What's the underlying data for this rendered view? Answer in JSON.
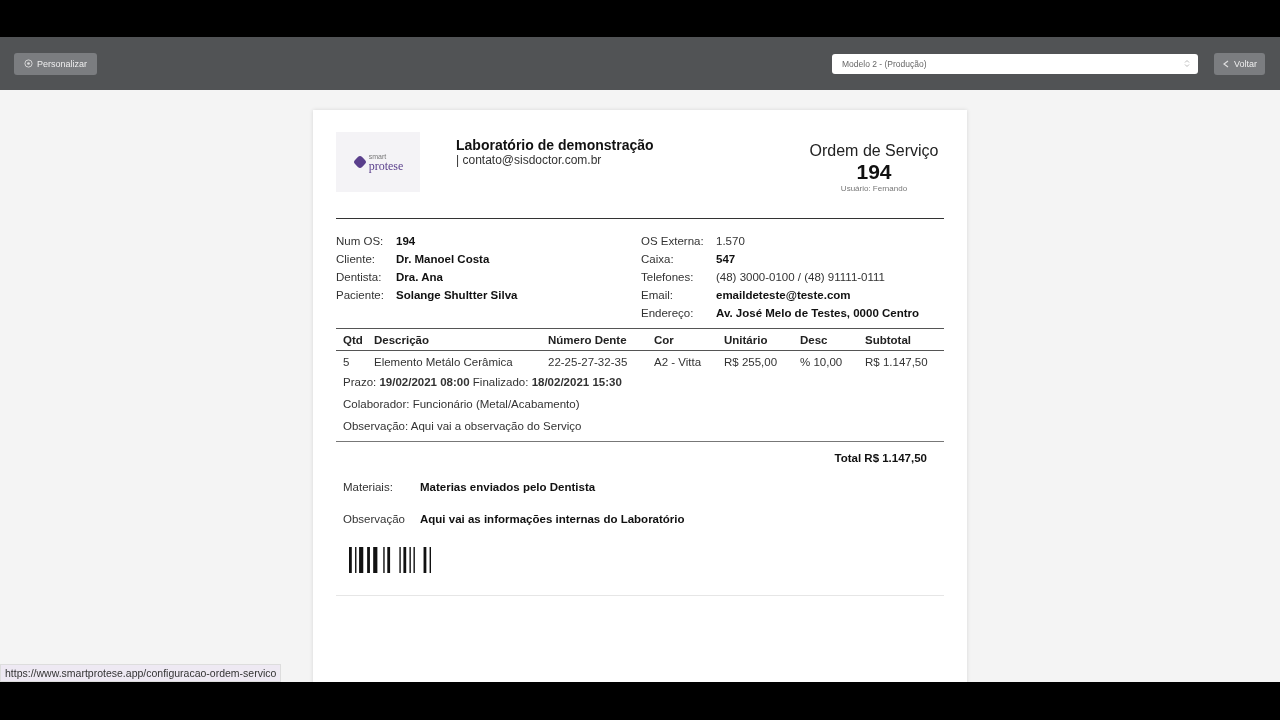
{
  "toolbar": {
    "customize_button": "Personalizar",
    "model_select": {
      "value": "Modelo 2 - (Produção)"
    },
    "back_button": "Voltar"
  },
  "document": {
    "logo": {
      "small": "smart",
      "text": "protese"
    },
    "lab_name": "Laboratório de demonstração",
    "lab_contact": "| contato@sisdoctor.com.br",
    "doc_title": "Ordem de Serviço",
    "doc_number": "194",
    "user": "Usuário: Fernando",
    "info_left": [
      {
        "label": "Num OS:",
        "value": "194"
      },
      {
        "label": "Cliente:",
        "value": "Dr. Manoel Costa"
      },
      {
        "label": "Dentista:",
        "value": "Dra. Ana"
      },
      {
        "label": "Paciente:",
        "value": "Solange Shultter Silva"
      }
    ],
    "info_right": [
      {
        "label": "OS Externa:",
        "value": "1.570",
        "bold": false
      },
      {
        "label": "Caixa:",
        "value": "547",
        "bold": true
      },
      {
        "label": "Telefones:",
        "value": "(48) 3000-0100 / (48) 91111-0111",
        "bold": false
      },
      {
        "label": "Email:",
        "value": "emaildeteste@teste.com",
        "bold": true
      },
      {
        "label": "Endereço:",
        "value": "Av. José Melo de Testes, 0000 Centro",
        "bold": true
      }
    ],
    "table": {
      "columns": [
        "Qtd",
        "Descrição",
        "Número Dente",
        "Cor",
        "Unitário",
        "Desc",
        "Subtotal"
      ],
      "rows": [
        {
          "cells": [
            "5",
            "Elemento Metálo Cerâmica",
            "22-25-27-32-35",
            "A2 - Vitta",
            "R$ 255,00",
            "% 10,00",
            "R$ 1.147,50"
          ],
          "details": [
            "Prazo: **19/02/2021 08:00** Finalizado: **18/02/2021 15:30**",
            "Colaborador: Funcionário (Metal/Acabamento)",
            "Observação: Aqui vai a observação do Serviço"
          ]
        }
      ]
    },
    "total": "Total R$ 1.147,50",
    "notes": [
      {
        "label": "Materiais:",
        "value": "Materias enviados pelo Dentista"
      },
      {
        "label": "Observação",
        "value": "Aqui vai as informações internas do Laboratório"
      }
    ]
  },
  "status_url": "https://www.smartprotese.app/configuracao-ordem-servico"
}
